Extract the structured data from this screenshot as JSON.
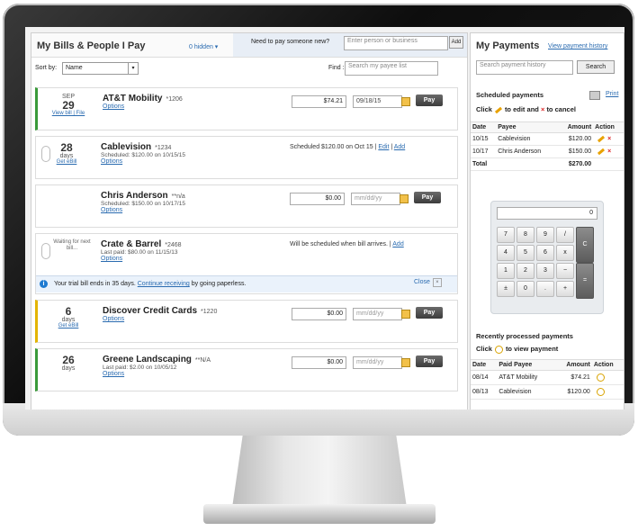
{
  "bills": {
    "title": "My Bills & People I Pay",
    "hidden_link": "0 hidden ▾",
    "pay_new_label": "Need to pay someone new?",
    "pay_new_placeholder": "Enter person or business",
    "add_label": "Add",
    "sort_label": "Sort by:",
    "sort_value": "Name",
    "find_label": "Find :",
    "find_placeholder": "Search my payee list",
    "rows": [
      {
        "month": "SEP",
        "day": "29",
        "links": "View bill | File",
        "name": "AT&T Mobility",
        "acct": "*1206",
        "sub": "",
        "options": "Options",
        "amount": "$74.21",
        "date": "09/18/15",
        "pay": "Pay"
      },
      {
        "day": "28",
        "days": "days",
        "link": "Get eBill",
        "name": "Cablevision",
        "acct": "*1234",
        "sub": "Scheduled: $120.00 on 10/15/15",
        "options": "Options",
        "status": "Scheduled $120.00 on Oct 15",
        "edit": "Edit",
        "add": "Add"
      },
      {
        "name": "Chris Anderson",
        "acct": "**n/a",
        "sub": "Scheduled: $150.00 on 10/17/15",
        "options": "Options",
        "amount": "$0.00",
        "date": "mm/dd/yy",
        "pay": "Pay"
      },
      {
        "waiting": "Waiting for next bill...",
        "name": "Crate & Barrel",
        "acct": "*2468",
        "sub": "Last paid: $80.00 on 11/15/13",
        "options": "Options",
        "status": "Will be scheduled when bill arrives.",
        "add": "Add",
        "trial_text": "Your trial bill ends in 35 days.",
        "trial_link": "Continue receiving",
        "trial_suffix": "by going paperless.",
        "close": "Close"
      },
      {
        "day": "6",
        "days": "days",
        "link": "Get eBill",
        "name": "Discover Credit Cards",
        "acct": "*1220",
        "sub": "",
        "options": "Options",
        "amount": "$0.00",
        "date": "mm/dd/yy",
        "pay": "Pay"
      },
      {
        "day": "26",
        "days": "days",
        "name": "Greene Landscaping",
        "acct": "**N/A",
        "sub": "Last paid: $2.00 on 10/05/12",
        "options": "Options",
        "amount": "$0.00",
        "date": "mm/dd/yy",
        "pay": "Pay"
      }
    ]
  },
  "payments": {
    "title": "My Payments",
    "history_link": "View payment history",
    "search_placeholder": "Search payment history",
    "search_btn": "Search",
    "scheduled_title": "Scheduled payments",
    "print": "Print",
    "hint_a": "Click",
    "hint_b": "to edit and",
    "hint_c": "to cancel",
    "cols": [
      "Date",
      "Payee",
      "Amount",
      "Action"
    ],
    "scheduled": [
      {
        "date": "10/15",
        "payee": "Cablevision",
        "amount": "$120.00"
      },
      {
        "date": "10/17",
        "payee": "Chris Anderson",
        "amount": "$150.00"
      }
    ],
    "total_label": "Total",
    "total_value": "$270.00",
    "calc_display": "0",
    "keys": [
      "7",
      "8",
      "9",
      "/",
      "C",
      "4",
      "5",
      "6",
      "x",
      "1",
      "2",
      "3",
      "−",
      "±",
      "0",
      ".",
      "+",
      "="
    ],
    "recent_title": "Recently processed payments",
    "recent_hint_a": "Click",
    "recent_hint_b": "to view payment",
    "recent_cols": [
      "Date",
      "Paid Payee",
      "Amount",
      "Action"
    ],
    "recent": [
      {
        "date": "08/14",
        "payee": "AT&T Mobility",
        "amount": "$74.21"
      },
      {
        "date": "08/13",
        "payee": "Cablevision",
        "amount": "$120.00"
      }
    ]
  }
}
